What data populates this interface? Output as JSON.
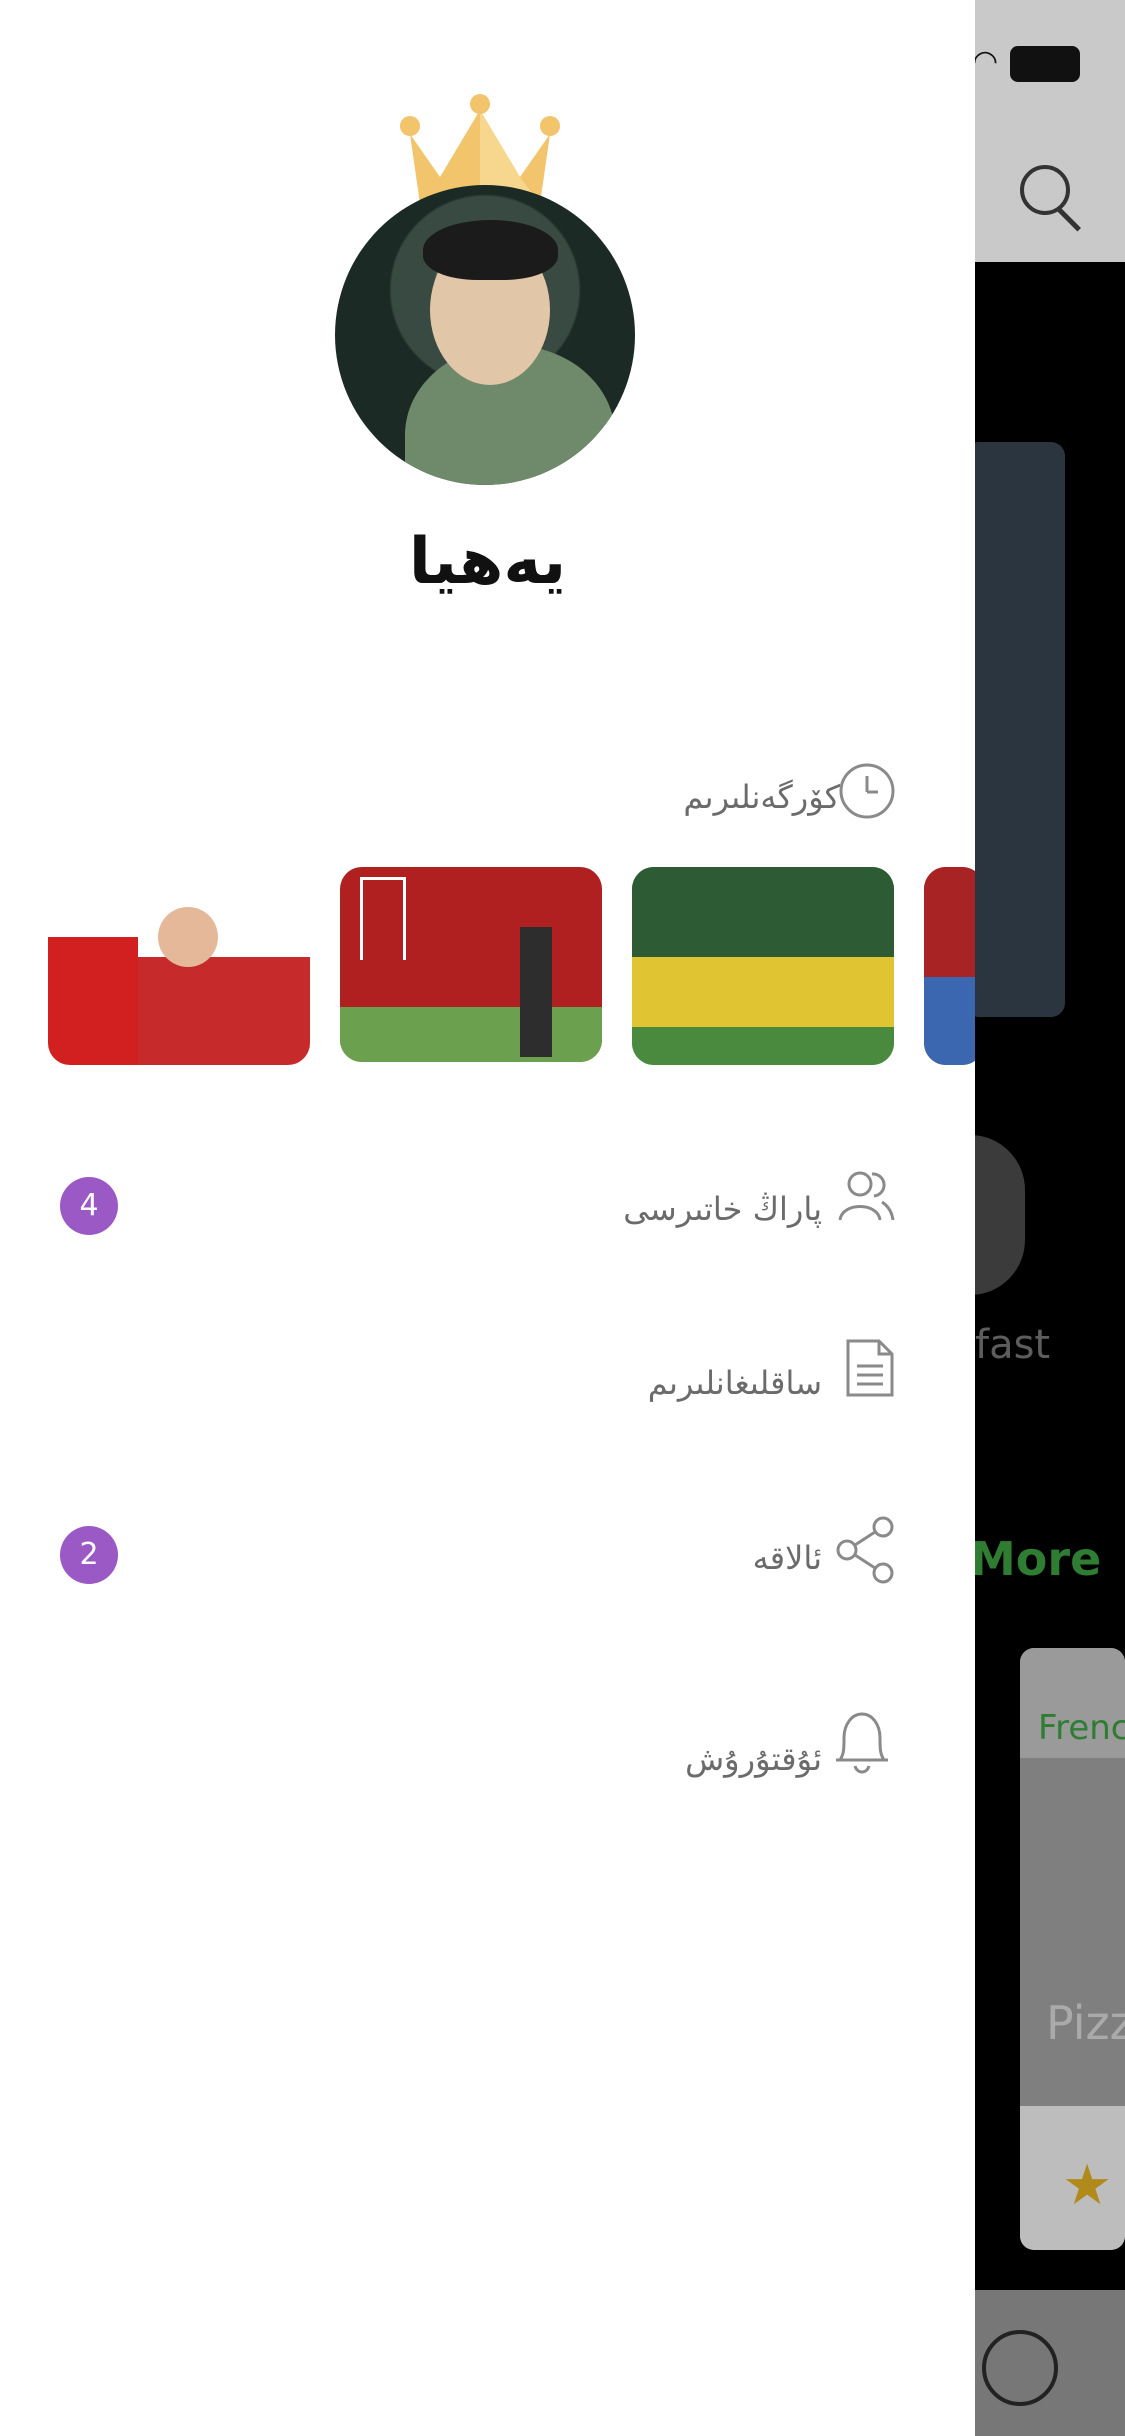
{
  "drawer": {
    "username": "يەھيا",
    "history": {
      "label": "كۆرگەنلىرىم",
      "icon": "clock-icon"
    },
    "thumbnails": [
      {
        "name": "fans-peru"
      },
      {
        "name": "manchester-united-coach"
      },
      {
        "name": "senegal-team"
      },
      {
        "name": "spain-team"
      }
    ],
    "menu": [
      {
        "label": "پاراڭ خاتىرسى",
        "icon": "users-icon",
        "badge": "4"
      },
      {
        "label": "ساقلىغانلىرىم",
        "icon": "document-icon",
        "badge": ""
      },
      {
        "label": "ئالاقە",
        "icon": "share-icon",
        "badge": "2"
      },
      {
        "label": "ئۇقتۇرۇش",
        "icon": "bell-icon",
        "badge": ""
      }
    ]
  },
  "background_app": {
    "category_label": "fast",
    "more_label": "More",
    "card_tag": "Frenc",
    "card_title": "Pizz"
  },
  "colors": {
    "badge": "#9b59c6",
    "accent_green": "#2e7d32",
    "crown": "#f2c46b"
  }
}
